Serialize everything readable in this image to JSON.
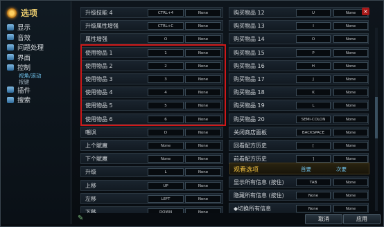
{
  "sidebar": {
    "title": "选项",
    "items": [
      {
        "label": "显示",
        "icon": "monitor-icon"
      },
      {
        "label": "音效",
        "icon": "speaker-icon"
      },
      {
        "label": "问题处理",
        "icon": "warning-icon"
      },
      {
        "label": "界面",
        "icon": "window-icon"
      },
      {
        "label": "控制",
        "icon": "controller-icon"
      }
    ],
    "sub_items": [
      {
        "label": "视角/滚动",
        "active": true
      },
      {
        "label": "按键",
        "active": false
      }
    ],
    "items2": [
      {
        "label": "插件",
        "icon": "tools-icon"
      },
      {
        "label": "搜索",
        "icon": "magnifier-icon"
      }
    ]
  },
  "left_rows": [
    {
      "label": "升级技能 4",
      "key1": "CTRL+4",
      "key2": "None"
    },
    {
      "label": "升级属性增强",
      "key1": "CTRL+C",
      "key2": "None"
    },
    {
      "label": "属性增强",
      "key1": "O",
      "key2": "None"
    },
    {
      "label": "使用物品 1",
      "key1": "1",
      "key2": "None"
    },
    {
      "label": "使用物品 2",
      "key1": "2",
      "key2": "None"
    },
    {
      "label": "使用物品 3",
      "key1": "3",
      "key2": "None"
    },
    {
      "label": "使用物品 4",
      "key1": "4",
      "key2": "None"
    },
    {
      "label": "使用物品 5",
      "key1": "5",
      "key2": "None"
    },
    {
      "label": "使用物品 6",
      "key1": "6",
      "key2": "None"
    },
    {
      "label": "嘲讽",
      "key1": "D",
      "key2": "None"
    },
    {
      "label": "上个賦魔",
      "key1": "None",
      "key2": "None"
    },
    {
      "label": "下个賦魔",
      "key1": "None",
      "key2": "None"
    },
    {
      "label": "升级",
      "key1": "L",
      "key2": "None"
    },
    {
      "label": "上移",
      "key1": "UP",
      "key2": "None"
    },
    {
      "label": "左移",
      "key1": "LEFT",
      "key2": "None"
    },
    {
      "label": "下移",
      "key1": "DOWN",
      "key2": "None"
    }
  ],
  "right_rows": [
    {
      "label": "购买物品 12",
      "key1": "U",
      "key2": "None"
    },
    {
      "label": "购买物品 13",
      "key1": "I",
      "key2": "None"
    },
    {
      "label": "购买物品 14",
      "key1": "O",
      "key2": "None"
    },
    {
      "label": "购买物品 15",
      "key1": "P",
      "key2": "None"
    },
    {
      "label": "购买物品 16",
      "key1": "H",
      "key2": "None"
    },
    {
      "label": "购买物品 17",
      "key1": "J",
      "key2": "None"
    },
    {
      "label": "购买物品 18",
      "key1": "K",
      "key2": "None"
    },
    {
      "label": "购买物品 19",
      "key1": "L",
      "key2": "None"
    },
    {
      "label": "购买物品 20",
      "key1": "SEMI-COLON",
      "key2": "None"
    },
    {
      "label": "关闭商店面板",
      "key1": "BACKSPACE",
      "key2": "None"
    },
    {
      "label": "回看配方历史",
      "key1": "[",
      "key2": "None"
    },
    {
      "label": "前看配方历史",
      "key1": "]",
      "key2": "None"
    }
  ],
  "right_rows2": [
    {
      "label": "显示所有信息 (按住)",
      "key1": "TAB",
      "key2": "None"
    },
    {
      "label": "隐藏所有信息 (按住)",
      "key1": "None",
      "key2": "None"
    },
    {
      "label": "◆切换所有信息",
      "key1": "None",
      "key2": "None"
    }
  ],
  "section": {
    "title": "观看选项",
    "col_a": "首要",
    "col_b": "次要"
  },
  "buttons": {
    "cancel": "取消",
    "apply": "应用"
  },
  "close_label": "×"
}
